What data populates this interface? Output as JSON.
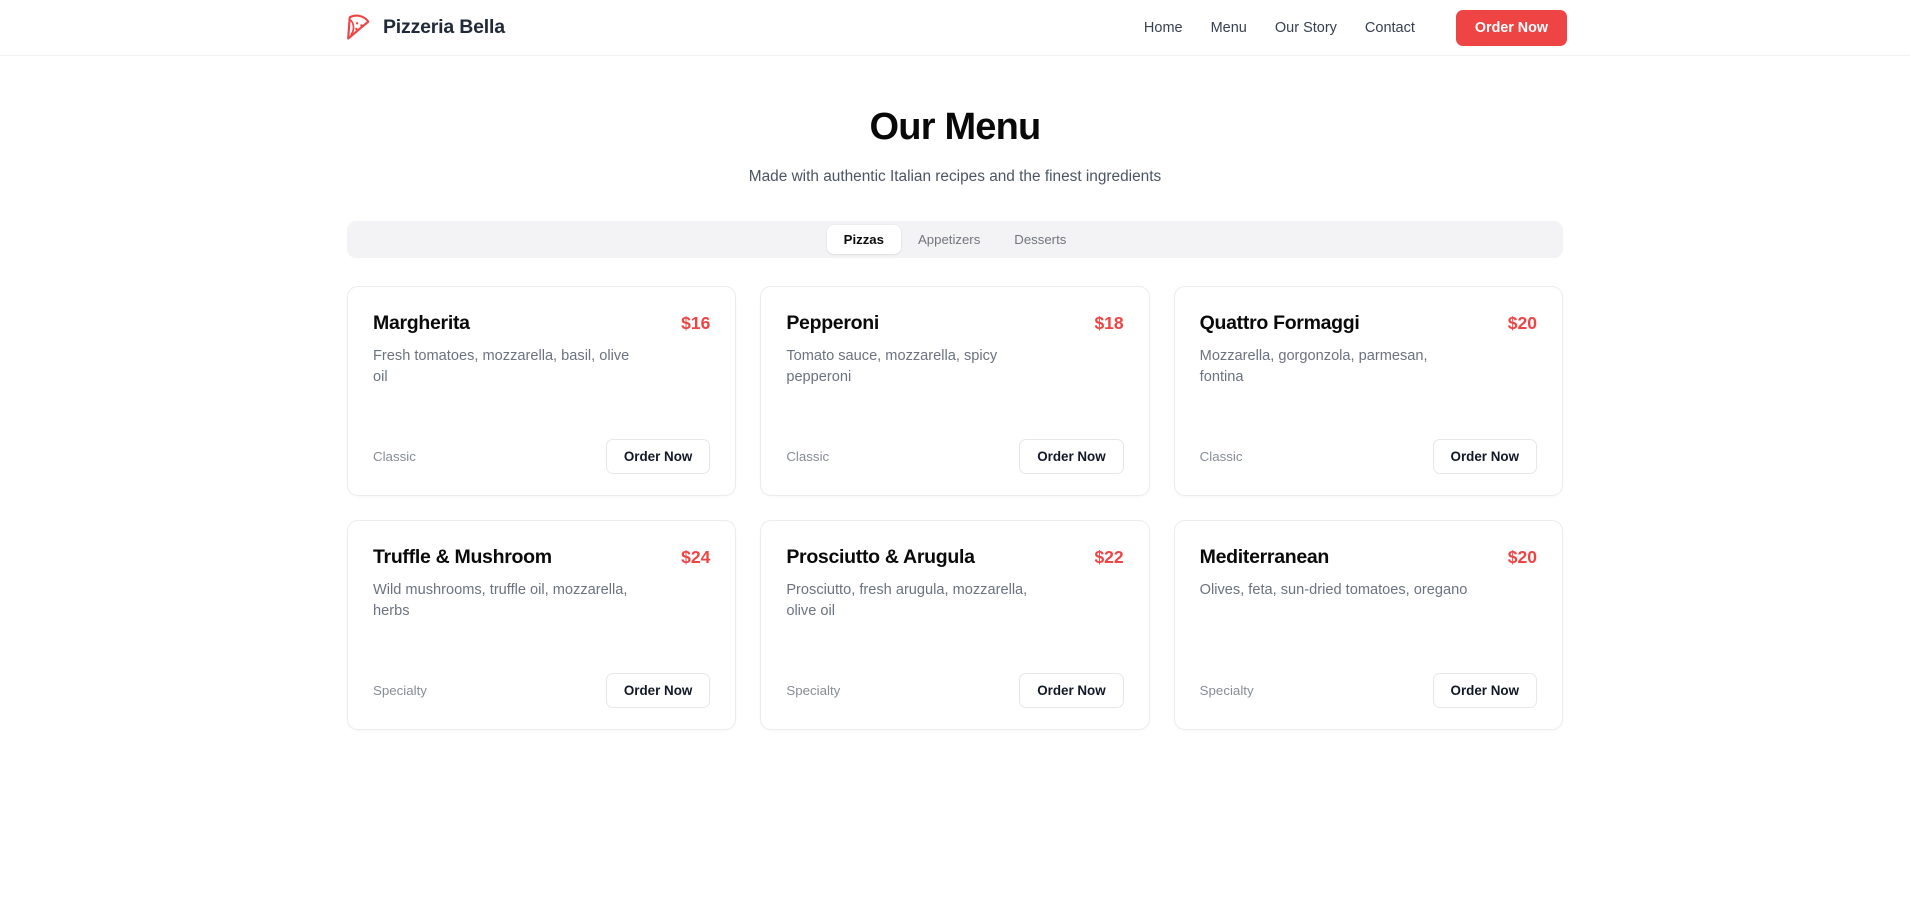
{
  "header": {
    "brand_name": "Pizzeria Bella",
    "brand_icon": "pizza-slice-icon",
    "nav_links": [
      "Home",
      "Menu",
      "Our Story",
      "Contact"
    ],
    "cta_label": "Order Now",
    "cta_color": "#ef4444"
  },
  "page": {
    "title": "Our Menu",
    "subtitle": "Made with authentic Italian recipes and the finest ingredients"
  },
  "tabs": {
    "items": [
      "Pizzas",
      "Appetizers",
      "Desserts"
    ],
    "active": "Pizzas",
    "bar_color": "#f3f3f5"
  },
  "menu": {
    "order_button_label": "Order Now",
    "items": [
      {
        "name": "Margherita",
        "price": "$16",
        "description": "Fresh tomatoes, mozzarella, basil, olive oil",
        "category": "Classic"
      },
      {
        "name": "Pepperoni",
        "price": "$18",
        "description": "Tomato sauce, mozzarella, spicy pepperoni",
        "category": "Classic"
      },
      {
        "name": "Quattro Formaggi",
        "price": "$20",
        "description": "Mozzarella, gorgonzola, parmesan, fontina",
        "category": "Classic"
      },
      {
        "name": "Truffle & Mushroom",
        "price": "$24",
        "description": "Wild mushrooms, truffle oil, mozzarella, herbs",
        "category": "Specialty"
      },
      {
        "name": "Prosciutto & Arugula",
        "price": "$22",
        "description": "Prosciutto, fresh arugula, mozzarella, olive oil",
        "category": "Specialty"
      },
      {
        "name": "Mediterranean",
        "price": "$20",
        "description": "Olives, feta, sun-dried tomatoes, oregano",
        "category": "Specialty"
      }
    ]
  }
}
